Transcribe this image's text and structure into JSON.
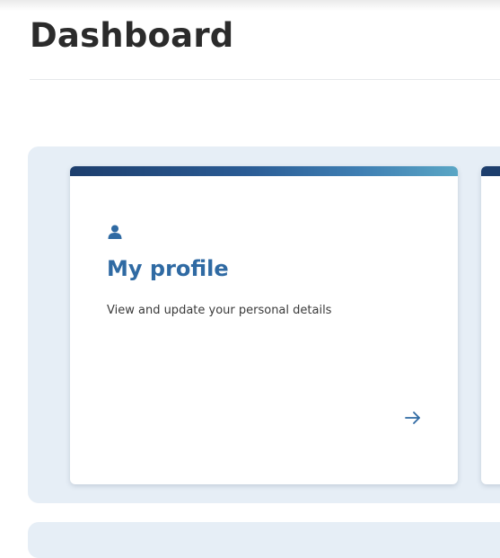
{
  "header": {
    "title": "Dashboard"
  },
  "cards": [
    {
      "icon": "user-icon",
      "title": "My profile",
      "description": "View and update your personal details",
      "action_icon": "arrow-right-icon"
    }
  ],
  "colors": {
    "accent": "#2f6aa3",
    "card_bar_start": "#1d3e6d",
    "card_bar_end": "#5aa6c5",
    "panel_background": "#e6eef6"
  }
}
